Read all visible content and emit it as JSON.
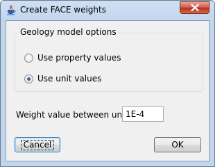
{
  "window": {
    "title": "Create FACE weights",
    "icon": "java-cup-icon",
    "close_icon": "close-icon"
  },
  "geology_group": {
    "title": "Geology model options",
    "options": [
      {
        "label": "Use property values",
        "checked": false
      },
      {
        "label": "Use unit values",
        "checked": true
      }
    ]
  },
  "weight": {
    "label": "Weight value between units:",
    "value": "1E-4"
  },
  "buttons": {
    "cancel": "Cancel",
    "ok": "OK"
  },
  "colors": {
    "close_red": "#c7432d",
    "dialog_bg": "#f0f0f0",
    "frame_blue": "#c2d6ee"
  }
}
